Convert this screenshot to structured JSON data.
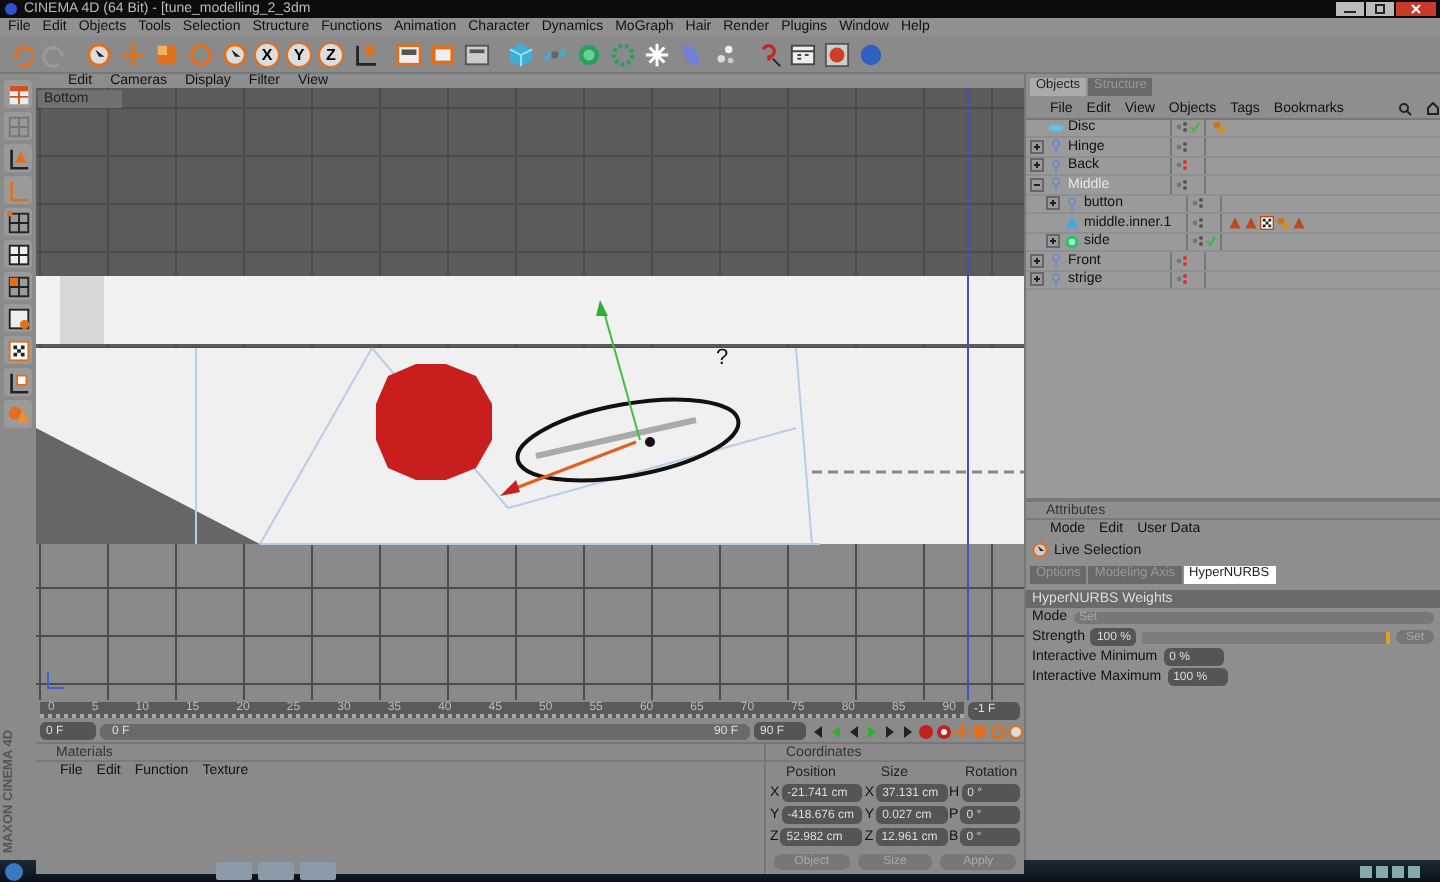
{
  "window": {
    "title": "CINEMA 4D (64 Bit) - [tune_modelling_2_3dm"
  },
  "menu": [
    "File",
    "Edit",
    "Objects",
    "Tools",
    "Selection",
    "Structure",
    "Functions",
    "Animation",
    "Character",
    "Dynamics",
    "MoGraph",
    "Hair",
    "Render",
    "Plugins",
    "Window",
    "Help"
  ],
  "toolbar": {
    "axis_buttons": [
      {
        "label": "X",
        "on": true
      },
      {
        "label": "Y",
        "on": true
      },
      {
        "label": "Z",
        "on": true
      }
    ]
  },
  "viewport": {
    "menu": [
      "Edit",
      "Cameras",
      "Display",
      "Filter",
      "View"
    ],
    "camera": "Bottom",
    "annotation": "?"
  },
  "objects": {
    "tabs": [
      {
        "label": "Objects",
        "selected": true
      },
      {
        "label": "Structure",
        "selected": false
      }
    ],
    "menu": [
      "File",
      "Edit",
      "View",
      "Objects",
      "Tags",
      "Bookmarks"
    ],
    "items": [
      {
        "name": "Disc",
        "kind": "disc",
        "selected": false,
        "checked": true,
        "hidden": false,
        "tags": [
          {
            "kind": "phong"
          }
        ]
      },
      {
        "name": "Hinge",
        "kind": "null",
        "selected": false,
        "checked": false,
        "hidden": false,
        "expanded": false
      },
      {
        "name": "Back",
        "kind": "null",
        "selected": false,
        "checked": false,
        "hidden": true,
        "expanded": false
      },
      {
        "name": "Middle",
        "kind": "null",
        "selected": true,
        "checked": false,
        "hidden": false,
        "expanded": true,
        "children": [
          {
            "name": "button",
            "kind": "null",
            "selected": false,
            "checked": false,
            "hidden": false,
            "expanded": false
          },
          {
            "name": "middle.inner.1",
            "kind": "polygon",
            "selected": false,
            "checked": false,
            "hidden": false,
            "tags": [
              {
                "kind": "cone"
              },
              {
                "kind": "cone"
              },
              {
                "kind": "checker"
              },
              {
                "kind": "phong"
              },
              {
                "kind": "cone"
              }
            ]
          },
          {
            "name": "side",
            "kind": "nurbs",
            "selected": false,
            "checked": true,
            "hidden": false,
            "expanded": false
          }
        ]
      },
      {
        "name": "Front",
        "kind": "null",
        "selected": false,
        "checked": false,
        "hidden": true,
        "expanded": false
      },
      {
        "name": "strige",
        "kind": "null",
        "selected": false,
        "checked": false,
        "hidden": true,
        "expanded": false
      }
    ]
  },
  "attributes": {
    "title": "Attributes",
    "menu": [
      "Mode",
      "Edit",
      "User Data"
    ],
    "tool": "Live Selection",
    "tabs": [
      {
        "label": "Options",
        "selected": false
      },
      {
        "label": "Modeling Axis",
        "selected": false
      },
      {
        "label": "HyperNURBS",
        "selected": true
      }
    ],
    "section": "HyperNURBS Weights",
    "fields": [
      {
        "kind": "dropdown",
        "label": "Mode",
        "value": "Set"
      },
      {
        "kind": "slider",
        "label": "Strength",
        "value": "100 %",
        "level": 1,
        "button": "Set"
      },
      {
        "kind": "number",
        "label": "Interactive Minimum",
        "value": "0 %"
      },
      {
        "kind": "number",
        "label": "Interactive Maximum",
        "value": "100 %"
      }
    ]
  },
  "timeline": {
    "ticks": [
      "0",
      "5",
      "10",
      "15",
      "20",
      "25",
      "30",
      "35",
      "40",
      "45",
      "50",
      "55",
      "60",
      "65",
      "70",
      "75",
      "80",
      "85",
      "90"
    ],
    "current": "-1 F",
    "start": "0 F",
    "range_start": "0 F",
    "range_end": "90 F",
    "level": 1,
    "end": "90 F"
  },
  "materials": {
    "title": "Materials",
    "menu": [
      "File",
      "Edit",
      "Function",
      "Texture"
    ]
  },
  "coordinates": {
    "title": "Coordinates",
    "headers": [
      "Position",
      "Size",
      "Rotation"
    ],
    "rows": [
      {
        "cells": [
          {
            "axis": "X",
            "value": "-21.741 cm"
          },
          {
            "axis": "X",
            "value": "37.131 cm"
          },
          {
            "axis": "H",
            "value": "0 °"
          }
        ]
      },
      {
        "cells": [
          {
            "axis": "Y",
            "value": "-418.676 cm"
          },
          {
            "axis": "Y",
            "value": "0.027 cm"
          },
          {
            "axis": "P",
            "value": "0 °"
          }
        ]
      },
      {
        "cells": [
          {
            "axis": "Z",
            "value": "52.982 cm"
          },
          {
            "axis": "Z",
            "value": "12.961 cm"
          },
          {
            "axis": "B",
            "value": "0 °"
          }
        ]
      }
    ],
    "mode": "Object",
    "size_mode": "Size",
    "apply": "Apply"
  },
  "brand": "MAXON CINEMA 4D"
}
